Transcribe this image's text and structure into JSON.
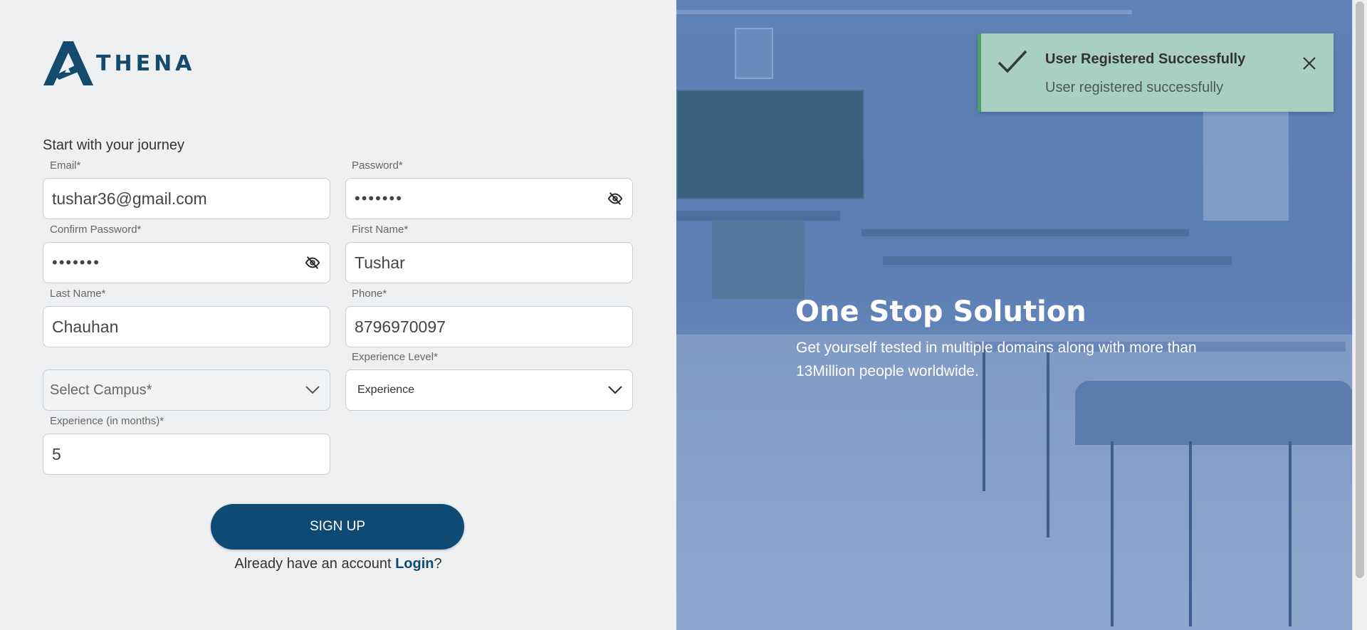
{
  "brand": {
    "name": "THENA"
  },
  "form": {
    "subtitle": "Start with your journey",
    "fields": {
      "email": {
        "label": "Email*",
        "value": "tushar36@gmail.com"
      },
      "password": {
        "label": "Password*",
        "value": "•••••••"
      },
      "confirm_password": {
        "label": "Confirm Password*",
        "value": "•••••••"
      },
      "first_name": {
        "label": "First Name*",
        "value": "Tushar"
      },
      "last_name": {
        "label": "Last Name*",
        "value": "Chauhan"
      },
      "phone": {
        "label": "Phone*",
        "value": "8796970097"
      },
      "campus": {
        "placeholder": "Select Campus*"
      },
      "experience_level": {
        "label": "Experience Level*",
        "value": "Experience"
      },
      "experience_months": {
        "label": "Experience (in months)*",
        "value": "5"
      }
    },
    "signup_label": "SIGN UP",
    "login_prompt": "Already have an account",
    "login_link": "Login",
    "login_suffix": "?"
  },
  "hero": {
    "title": "One Stop Solution",
    "subtitle": "Get yourself tested in multiple domains along with more than 13Million people worldwide."
  },
  "toast": {
    "title": "User Registered Successfully",
    "message": "User registered successfully"
  },
  "colors": {
    "primary": "#0e4a74",
    "toast_bg": "#a9cfc0",
    "toast_accent": "#4e9d6a",
    "hero_overlay": "#5f82b6"
  }
}
